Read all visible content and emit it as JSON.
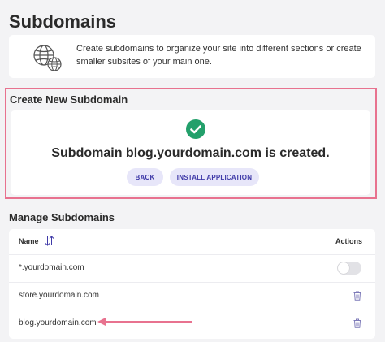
{
  "page": {
    "title": "Subdomains"
  },
  "info": {
    "icon": "globe-icon",
    "text": "Create subdomains to organize your site into different sections or create smaller subsites of your main one."
  },
  "create_section": {
    "title": "Create New Subdomain",
    "status_icon": "check-circle-icon",
    "status_color": "#23a06b",
    "message": "Subdomain blog.yourdomain.com is created.",
    "back_label": "BACK",
    "install_label": "INSTALL APPLICATION"
  },
  "manage_section": {
    "title": "Manage Subdomains",
    "columns": {
      "name": "Name",
      "actions": "Actions"
    },
    "rows": [
      {
        "name": "*.yourdomain.com",
        "action": "toggle",
        "toggle_on": false
      },
      {
        "name": "store.yourdomain.com",
        "action": "trash-icon"
      },
      {
        "name": "blog.yourdomain.com",
        "action": "trash-icon"
      }
    ]
  },
  "colors": {
    "highlight_border": "#e8728f",
    "button_bg": "#e7e6f9",
    "button_text": "#3f3aa8",
    "annotation_arrow": "#e8728f"
  }
}
